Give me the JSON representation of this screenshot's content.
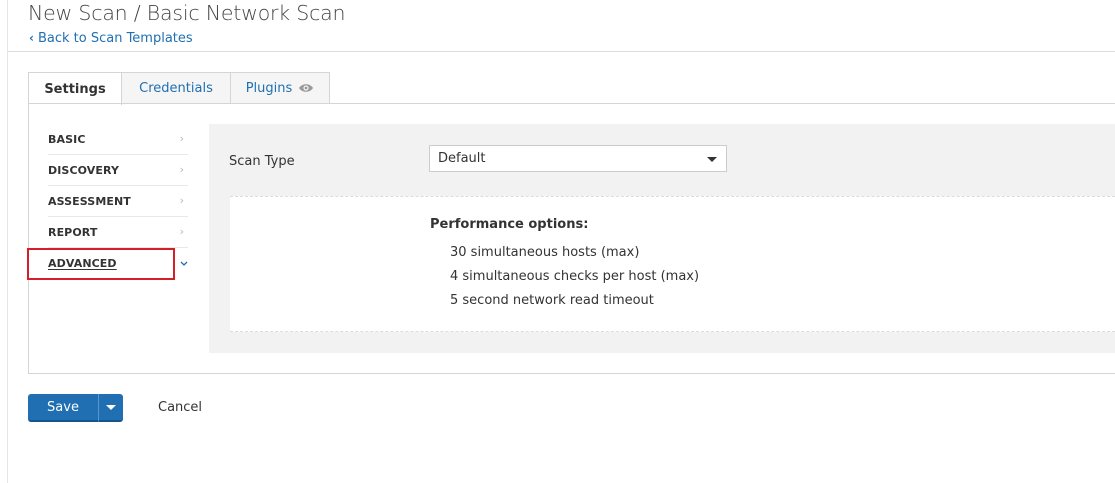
{
  "header": {
    "title": "New Scan / Basic Network Scan",
    "back_link": "Back to Scan Templates"
  },
  "tabs": [
    {
      "label": "Settings",
      "active": true
    },
    {
      "label": "Credentials",
      "active": false
    },
    {
      "label": "Plugins",
      "active": false,
      "icon": "eye-icon"
    }
  ],
  "sidenav": {
    "items": [
      {
        "label": "BASIC",
        "icon": "chevron-right-icon"
      },
      {
        "label": "DISCOVERY",
        "icon": "chevron-right-icon"
      },
      {
        "label": "ASSESSMENT",
        "icon": "chevron-right-icon"
      },
      {
        "label": "REPORT",
        "icon": "chevron-right-icon"
      },
      {
        "label": "ADVANCED",
        "icon": "chevron-down-icon",
        "selected": true
      }
    ]
  },
  "form": {
    "scan_type_label": "Scan Type",
    "scan_type_value": "Default"
  },
  "performance": {
    "title": "Performance options:",
    "options": [
      "30 simultaneous hosts (max)",
      "4 simultaneous checks per host (max)",
      "5 second network read timeout"
    ]
  },
  "actions": {
    "save_label": "Save",
    "cancel_label": "Cancel"
  },
  "colors": {
    "link": "#1f6fb2",
    "primary_button": "#1f6fb2",
    "highlight_box": "#d32027",
    "content_background": "#f2f2f2"
  }
}
